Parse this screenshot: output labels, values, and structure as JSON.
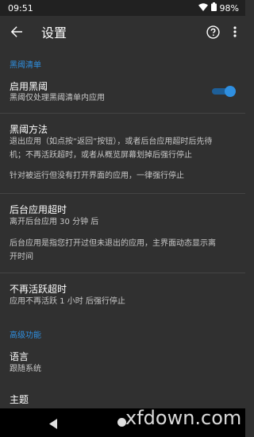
{
  "status_bar": {
    "time": "09:51",
    "battery": "98%"
  },
  "toolbar": {
    "title": "设置"
  },
  "sections": {
    "blocklist_header": "黑阈清单",
    "advanced_header": "高级功能"
  },
  "prefs": {
    "enable": {
      "title": "启用黑阈",
      "summary": "黑阈仅处理黑阈清单内应用",
      "toggle_on": true
    },
    "method": {
      "title": "黑阈方法",
      "summary_line1": "退出应用（如点按“返回”按钮），或者后台应用超时后先待",
      "summary_line2": "机；不再活跃超时，或者从概览屏幕划掉后强行停止",
      "summary_line3": "针对被运行但没有打开界面的应用，一律强行停止"
    },
    "bg_timeout": {
      "title": "后台应用超时",
      "summary_line1": "离开后台应用 30 分钟 后",
      "summary_line2": "后台应用是指您打开过但未退出的应用，主界面动态显示离",
      "summary_line3": "开时间"
    },
    "inactive_timeout": {
      "title": "不再活跃超时",
      "summary": "应用不再活跃 1 小时 后强行停止"
    },
    "language": {
      "title": "语言",
      "summary": "跟随系统"
    },
    "theme": {
      "title": "主题"
    }
  },
  "watermark": "xfdown.com",
  "colors": {
    "background": "#303030",
    "accent": "#2f8fe0",
    "status_bar": "#212121",
    "nav_bar": "#000000"
  },
  "icons": {
    "wifi": "wifi-icon",
    "battery": "battery-icon",
    "back": "arrow-back-icon",
    "help": "help-circle-icon",
    "more": "more-vert-icon",
    "nav_back": "nav-back-triangle-icon",
    "nav_home": "nav-home-circle-icon"
  }
}
